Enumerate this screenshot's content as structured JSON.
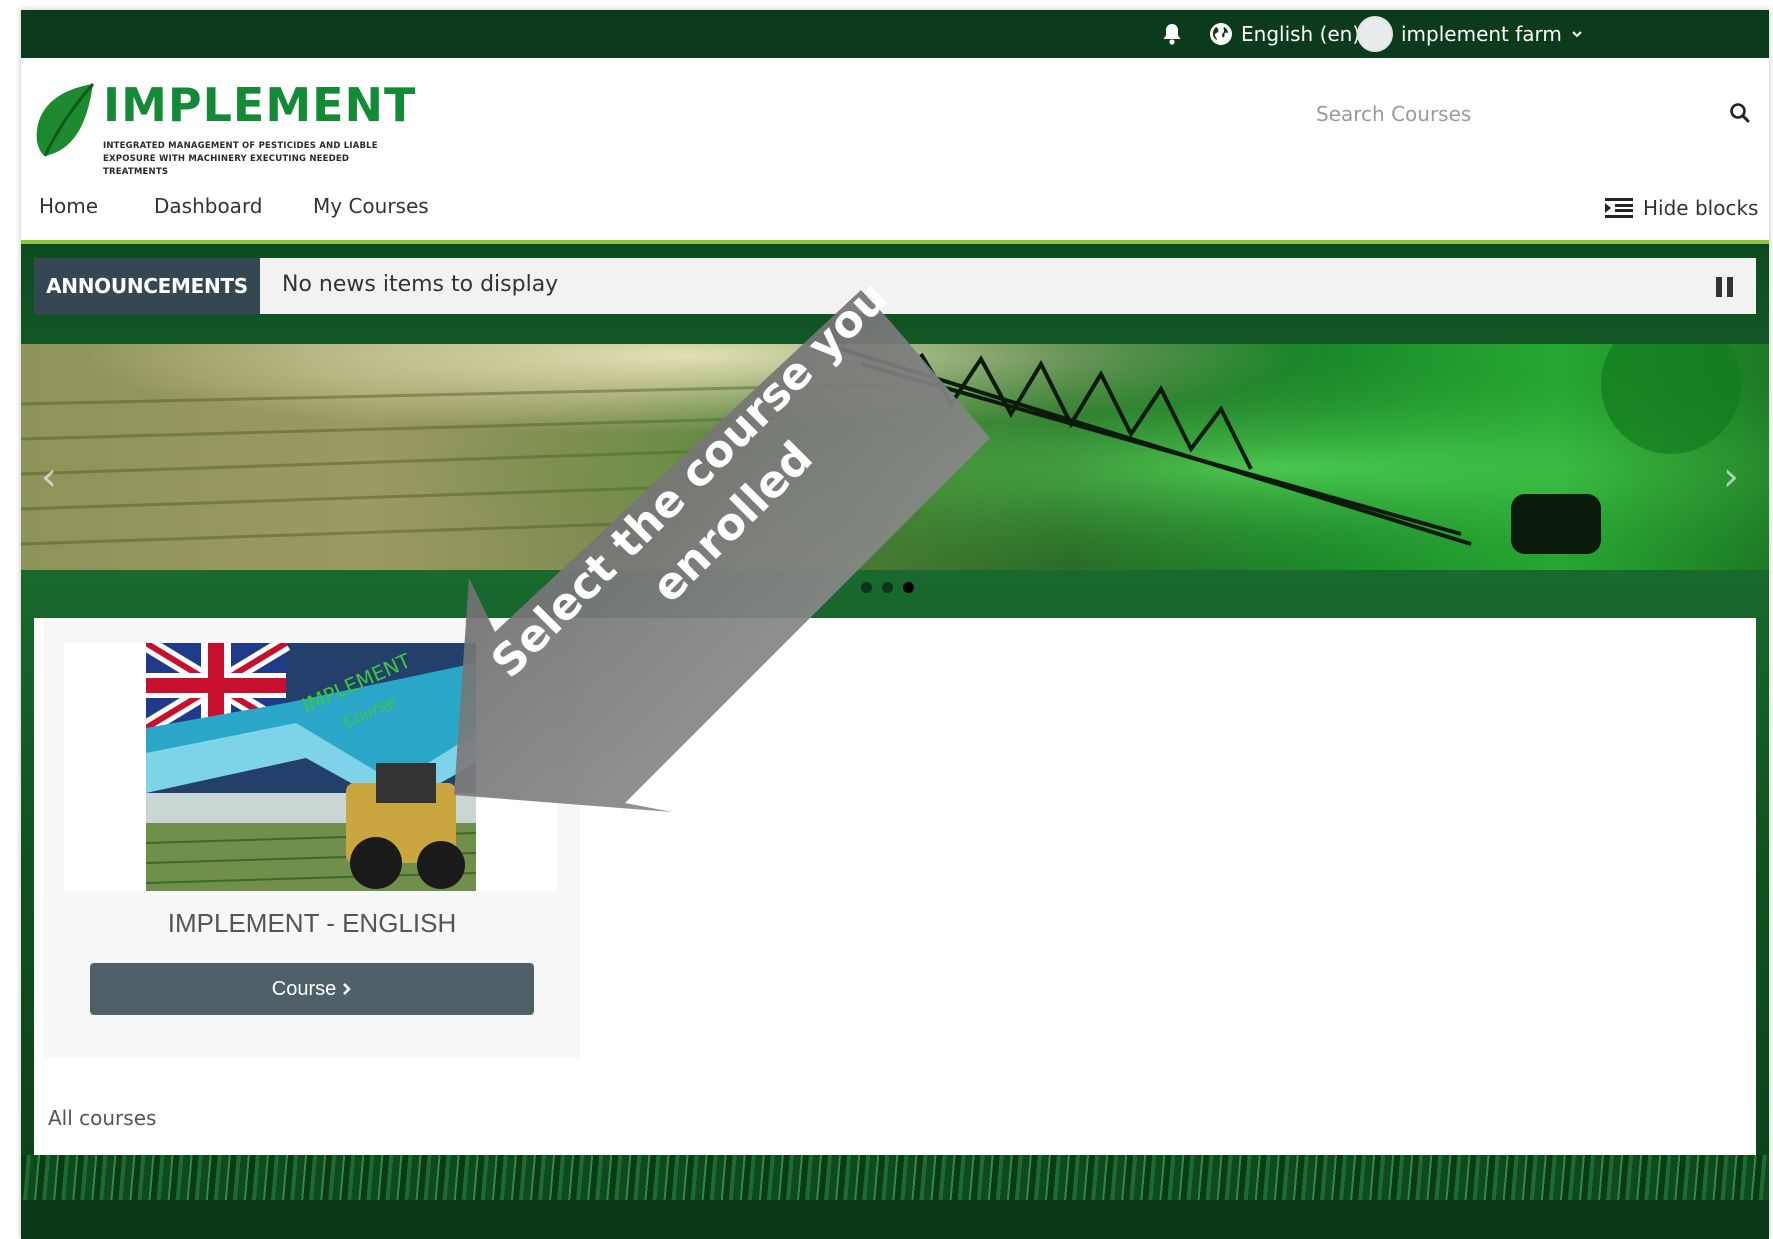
{
  "topbar": {
    "language": "English (en)",
    "user_name": "implement farm"
  },
  "header": {
    "logo_word": "IMPLEMENT",
    "logo_sub_line1": "INTEGRATED MANAGEMENT OF PESTICIDES AND LIABLE",
    "logo_sub_line2": "EXPOSURE WITH MACHINERY EXECUTING NEEDED TREATMENTS",
    "search_placeholder": "Search Courses"
  },
  "nav": {
    "items": [
      {
        "label": "Home"
      },
      {
        "label": "Dashboard"
      },
      {
        "label": "My Courses"
      }
    ],
    "hide_blocks": "Hide blocks"
  },
  "announcements": {
    "label": "ANNOUNCEMENTS",
    "text": "No news items to display"
  },
  "slider": {
    "active_index": 2,
    "count": 3
  },
  "course": {
    "thumb_text_1": "IMPLEMENT",
    "thumb_text_2": "Course",
    "title": "IMPLEMENT - ENGLISH",
    "button_label": "Course"
  },
  "all_courses": "All courses",
  "callout": {
    "line1": "Select the course you",
    "line2": "enrolled"
  },
  "colors": {
    "topbar": "#0c3a1c",
    "accent": "#8cc63f",
    "announcement_label": "#354752",
    "course_button": "#4f6069"
  }
}
